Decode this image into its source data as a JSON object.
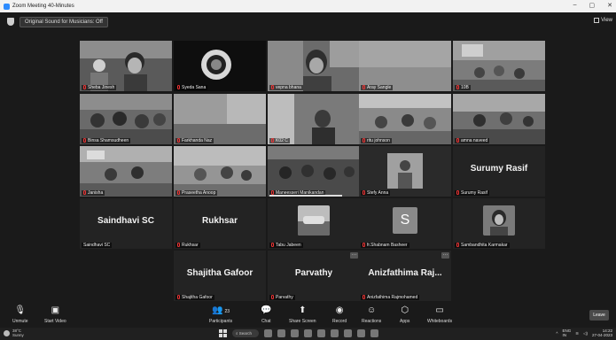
{
  "window": {
    "title": "Zoom Meeting 40-Minutes",
    "controls": [
      "–",
      "▢",
      "✕"
    ]
  },
  "topbar": {
    "original_sound": "Original Sound for Musicians: Off",
    "view_label": "View"
  },
  "participants": [
    {
      "name": "Sheba Jinesh",
      "type": "video"
    },
    {
      "name": "Syeda Sana",
      "type": "video"
    },
    {
      "name": "vepna bhana",
      "type": "video"
    },
    {
      "name": "Aray Sangle",
      "type": "video"
    },
    {
      "name": "10B",
      "type": "video"
    },
    {
      "name": "Binsa Shamsudheen",
      "type": "video"
    },
    {
      "name": "Farkhanda Naz",
      "type": "video"
    },
    {
      "name": "K02 C",
      "type": "video"
    },
    {
      "name": "ritu johnson",
      "type": "video"
    },
    {
      "name": "amna naveed",
      "type": "video"
    },
    {
      "name": "Janisha",
      "type": "video"
    },
    {
      "name": "Praseetha Anoop",
      "type": "video"
    },
    {
      "name": "Maneesseri Manikandan",
      "type": "video"
    },
    {
      "name": "Stefy Anna",
      "type": "video"
    },
    {
      "name": "Surumy Rasif",
      "type": "name",
      "display": "Surumy Rasif"
    },
    {
      "name": "Saindhavi SC",
      "type": "name",
      "display": "Saindhavi SC"
    },
    {
      "name": "Rukhsar",
      "type": "name",
      "display": "Rukhsar"
    },
    {
      "name": "Tabu Jabeen",
      "type": "avatar"
    },
    {
      "name": "fr.Shabnam Basheer",
      "type": "letter",
      "letter": "S"
    },
    {
      "name": "Sambandhita Karmakar",
      "type": "avatar"
    },
    {
      "name": "Shajitha Gafoor",
      "type": "name",
      "display": "Shajitha Gafoor"
    },
    {
      "name": "Parvathy",
      "type": "name",
      "display": "Parvathy"
    },
    {
      "name": "Anizfathima Rajmohamed",
      "type": "name",
      "display": "Anizfathima  Raj..."
    }
  ],
  "toolbar": {
    "unmute": "Unmute",
    "start_video": "Start Video",
    "participants": "Participants",
    "participant_count": "23",
    "chat": "Chat",
    "share_screen": "Share Screen",
    "record": "Record",
    "reactions": "Reactions",
    "apps": "Apps",
    "whiteboards": "Whiteboards",
    "leave": "Leave"
  },
  "taskbar": {
    "temperature": "38°C",
    "weather": "Sunny",
    "search": "Search",
    "lang": "ENG",
    "region": "IN",
    "time": "14:22",
    "date": "27-04-2023"
  }
}
